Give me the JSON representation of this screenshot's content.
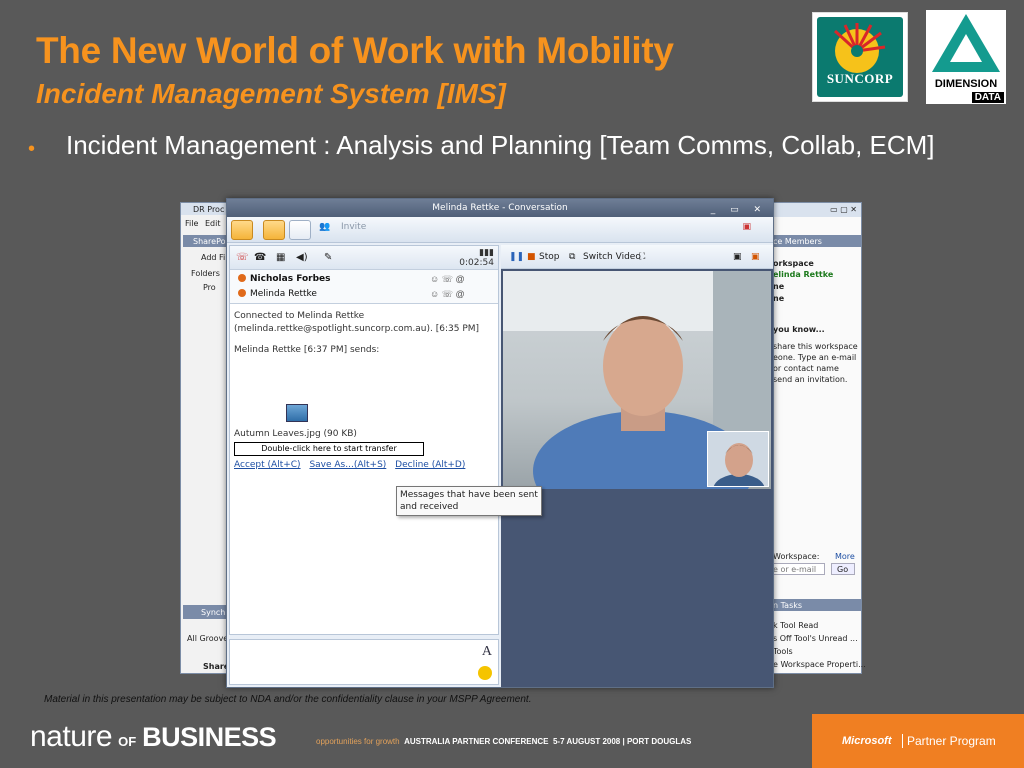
{
  "slide": {
    "title": "The New World of Work with Mobility",
    "subtitle": "Incident Management System [IMS]",
    "bullet": "Incident Management : Analysis and Planning [Team Comms, Collab, ECM]",
    "logos": {
      "suncorp": "SUNCORP",
      "dimension_data_1": "DIMENSION",
      "dimension_data_2": "DATA"
    },
    "disclaimer": "Material in this presentation may be subject to NDA and/or the confidentiality clause in your MSPP Agreement.",
    "footer": {
      "brand_nature": "nature",
      "brand_of": "OF",
      "brand_business": "BUSINESS",
      "tagline_prefix": "opportunities for growth",
      "tagline_main": "AUSTRALIA PARTNER CONFERENCE",
      "tagline_suffix": "5-7 AUGUST 2008 | PORT DOUGLAS",
      "ms_logo": "Microsoft",
      "ms_program": "Partner Program"
    }
  },
  "conversation": {
    "window_title": "Melinda Rettke - Conversation",
    "invite_label": "Invite",
    "timer": "0:02:54",
    "participants": [
      "Nicholas Forbes",
      "Melinda Rettke"
    ],
    "messages": {
      "connected_1": "Connected to Melinda Rettke",
      "connected_2": "(melinda.rettke@spotlight.suncorp.com.au).  [6:35 PM]",
      "sends": "Melinda Rettke [6:37 PM] sends:",
      "file": "Autumn Leaves.jpg (90 KB)",
      "transfer_button": "Double-click here to start transfer",
      "accept": "Accept (Alt+C)",
      "save_as": "Save As...(Alt+S)",
      "decline": "Decline (Alt+D)"
    },
    "video_bar": {
      "stop": "Stop",
      "switch_video": "Switch Video"
    },
    "tooltip": "Messages that have been sent and received"
  },
  "background_left": {
    "title": "DR Proc",
    "menu": [
      "File",
      "Edit"
    ],
    "sharepoint": "SharePoi",
    "add": "Add Fi",
    "folders": "Folders",
    "pro": "Pro",
    "synch": "Synch",
    "all_groove": "All Groove",
    "share": "Share"
  },
  "background_right": {
    "members_header": "ce Members",
    "workspace": "orkspace",
    "member": "elinda Rettke",
    "line_ne1": "ne",
    "line_ne2": "ne",
    "did_you_know": "you know...",
    "tip_1": "share this workspace",
    "tip_2": "eone.  Type an e-mail",
    "tip_3": "or contact name",
    "tip_4": "send an invitation.",
    "workspace_label": "Workspace:",
    "more": "More",
    "email_placeholder": "e or e-mail",
    "go": "Go",
    "tasks_header": "n Tasks",
    "task_1": "k Tool Read",
    "task_2": "s Off Tool's Unread ...",
    "task_3": "Tools",
    "task_4": "e Workspace Properti..."
  }
}
